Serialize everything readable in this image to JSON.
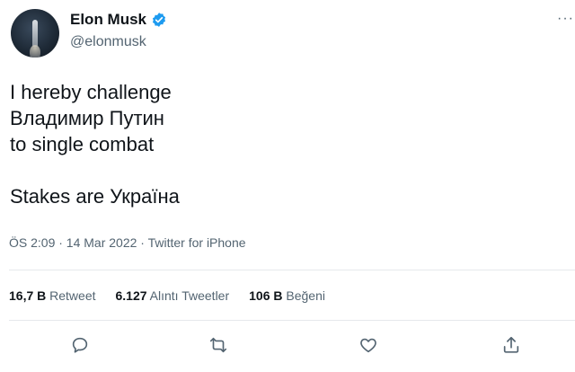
{
  "author": {
    "display_name": "Elon Musk",
    "handle": "@elonmusk",
    "verified": true,
    "avatar_icon": "rocket-launch-avatar"
  },
  "tweet": {
    "text": "I hereby challenge\nВладимир Путин\nto single combat\n\nStakes are Україна",
    "meta": "ÖS 2:09 · 14 Mar 2022 · Twitter for iPhone"
  },
  "stats": {
    "retweets_count": "16,7 B",
    "retweets_label": "Retweet",
    "quotes_count": "6.127",
    "quotes_label": "Alıntı Tweetler",
    "likes_count": "106 B",
    "likes_label": "Beğeni"
  },
  "actions": {
    "icons": [
      "reply-icon",
      "retweet-icon",
      "like-icon",
      "share-icon"
    ]
  },
  "colors": {
    "text": "#0f1419",
    "secondary": "#536471",
    "verified": "#1d9bf0",
    "divider": "#e6e9ec"
  }
}
